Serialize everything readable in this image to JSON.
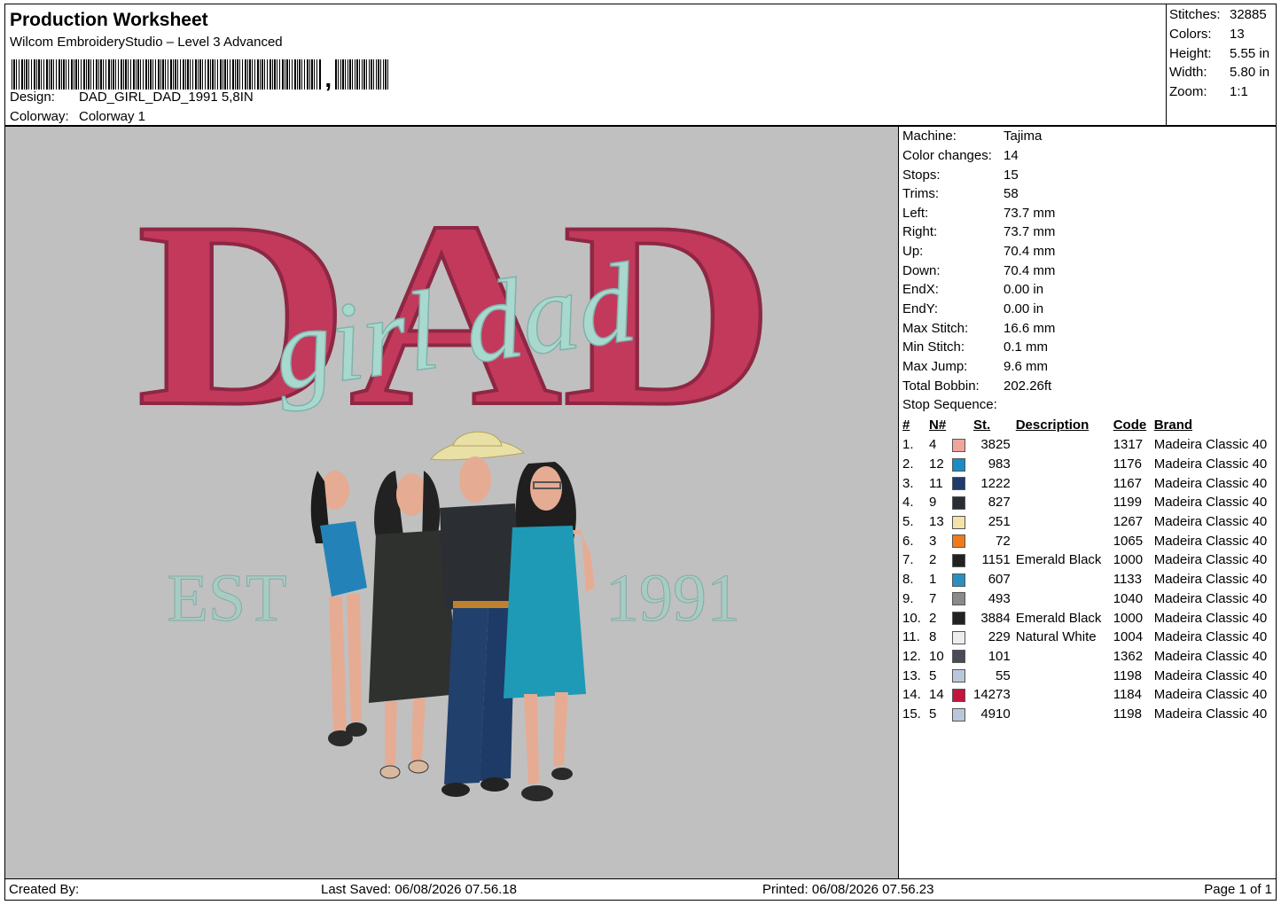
{
  "header": {
    "title": "Production Worksheet",
    "software": "Wilcom EmbroideryStudio – Level 3 Advanced",
    "design_label": "Design:",
    "design_value": "DAD_GIRL_DAD_1991 5,8IN",
    "colorway_label": "Colorway:",
    "colorway_value": "Colorway 1"
  },
  "stats": {
    "stitches_label": "Stitches:",
    "stitches": "32885",
    "colors_label": "Colors:",
    "colors": "13",
    "height_label": "Height:",
    "height": "5.55 in",
    "width_label": "Width:",
    "width": "5.80 in",
    "zoom_label": "Zoom:",
    "zoom": "1:1"
  },
  "design_art": {
    "main_word": "DAD",
    "script_text": "girl dad",
    "left_text": "EST",
    "right_text": "1991",
    "colors": {
      "dad": "#c2395c",
      "script": "#a9d8cf",
      "est": "#a7ccc4",
      "background": "#c0c0c0"
    }
  },
  "machine": {
    "machine_label": "Machine:",
    "machine": "Tajima",
    "color_changes_label": "Color changes:",
    "color_changes": "14",
    "stops_label": "Stops:",
    "stops": "15",
    "trims_label": "Trims:",
    "trims": "58",
    "left_label": "Left:",
    "left": "73.7 mm",
    "right_label": "Right:",
    "right": "73.7 mm",
    "up_label": "Up:",
    "up": "70.4 mm",
    "down_label": "Down:",
    "down": "70.4 mm",
    "endx_label": "EndX:",
    "endx": "0.00 in",
    "endy_label": "EndY:",
    "endy": "0.00 in",
    "max_stitch_label": "Max Stitch:",
    "max_stitch": "16.6 mm",
    "min_stitch_label": "Min Stitch:",
    "min_stitch": "0.1 mm",
    "max_jump_label": "Max Jump:",
    "max_jump": "9.6 mm",
    "total_bobbin_label": "Total Bobbin:",
    "total_bobbin": "202.26ft",
    "stop_sequence_label": "Stop Sequence:"
  },
  "sequence": {
    "headers": {
      "idx": "#",
      "n": "N#",
      "st": "St.",
      "desc": "Description",
      "code": "Code",
      "brand": "Brand"
    },
    "rows": [
      {
        "idx": "1.",
        "n": "4",
        "color": "#f0a59c",
        "st": "3825",
        "desc": "",
        "code": "1317",
        "brand": "Madeira Classic 40"
      },
      {
        "idx": "2.",
        "n": "12",
        "color": "#1a8cc6",
        "st": "983",
        "desc": "",
        "code": "1176",
        "brand": "Madeira Classic 40"
      },
      {
        "idx": "3.",
        "n": "11",
        "color": "#1e3a6e",
        "st": "1222",
        "desc": "",
        "code": "1167",
        "brand": "Madeira Classic 40"
      },
      {
        "idx": "4.",
        "n": "9",
        "color": "#2a2d35",
        "st": "827",
        "desc": "",
        "code": "1199",
        "brand": "Madeira Classic 40"
      },
      {
        "idx": "5.",
        "n": "13",
        "color": "#f2e3a8",
        "st": "251",
        "desc": "",
        "code": "1267",
        "brand": "Madeira Classic 40"
      },
      {
        "idx": "6.",
        "n": "3",
        "color": "#f07b1e",
        "st": "72",
        "desc": "",
        "code": "1065",
        "brand": "Madeira Classic 40"
      },
      {
        "idx": "7.",
        "n": "2",
        "color": "#222222",
        "st": "1151",
        "desc": "Emerald Black",
        "code": "1000",
        "brand": "Madeira Classic 40"
      },
      {
        "idx": "8.",
        "n": "1",
        "color": "#2c8fc4",
        "st": "607",
        "desc": "",
        "code": "1133",
        "brand": "Madeira Classic 40"
      },
      {
        "idx": "9.",
        "n": "7",
        "color": "#8a8a8a",
        "st": "493",
        "desc": "",
        "code": "1040",
        "brand": "Madeira Classic 40"
      },
      {
        "idx": "10.",
        "n": "2",
        "color": "#222222",
        "st": "3884",
        "desc": "Emerald Black",
        "code": "1000",
        "brand": "Madeira Classic 40"
      },
      {
        "idx": "11.",
        "n": "8",
        "color": "#eeeef2",
        "st": "229",
        "desc": "Natural White",
        "code": "1004",
        "brand": "Madeira Classic 40"
      },
      {
        "idx": "12.",
        "n": "10",
        "color": "#4a4a58",
        "st": "101",
        "desc": "",
        "code": "1362",
        "brand": "Madeira Classic 40"
      },
      {
        "idx": "13.",
        "n": "5",
        "color": "#b8c8d8",
        "st": "55",
        "desc": "",
        "code": "1198",
        "brand": "Madeira Classic 40"
      },
      {
        "idx": "14.",
        "n": "14",
        "color": "#c2163e",
        "st": "14273",
        "desc": "",
        "code": "1184",
        "brand": "Madeira Classic 40"
      },
      {
        "idx": "15.",
        "n": "5",
        "color": "#b8c8d8",
        "st": "4910",
        "desc": "",
        "code": "1198",
        "brand": "Madeira Classic 40"
      }
    ]
  },
  "footer": {
    "created_by": "Created By:",
    "last_saved": "Last Saved: 06/08/2026 07.56.18",
    "printed": "Printed: 06/08/2026 07.56.23",
    "page": "Page 1 of 1"
  }
}
